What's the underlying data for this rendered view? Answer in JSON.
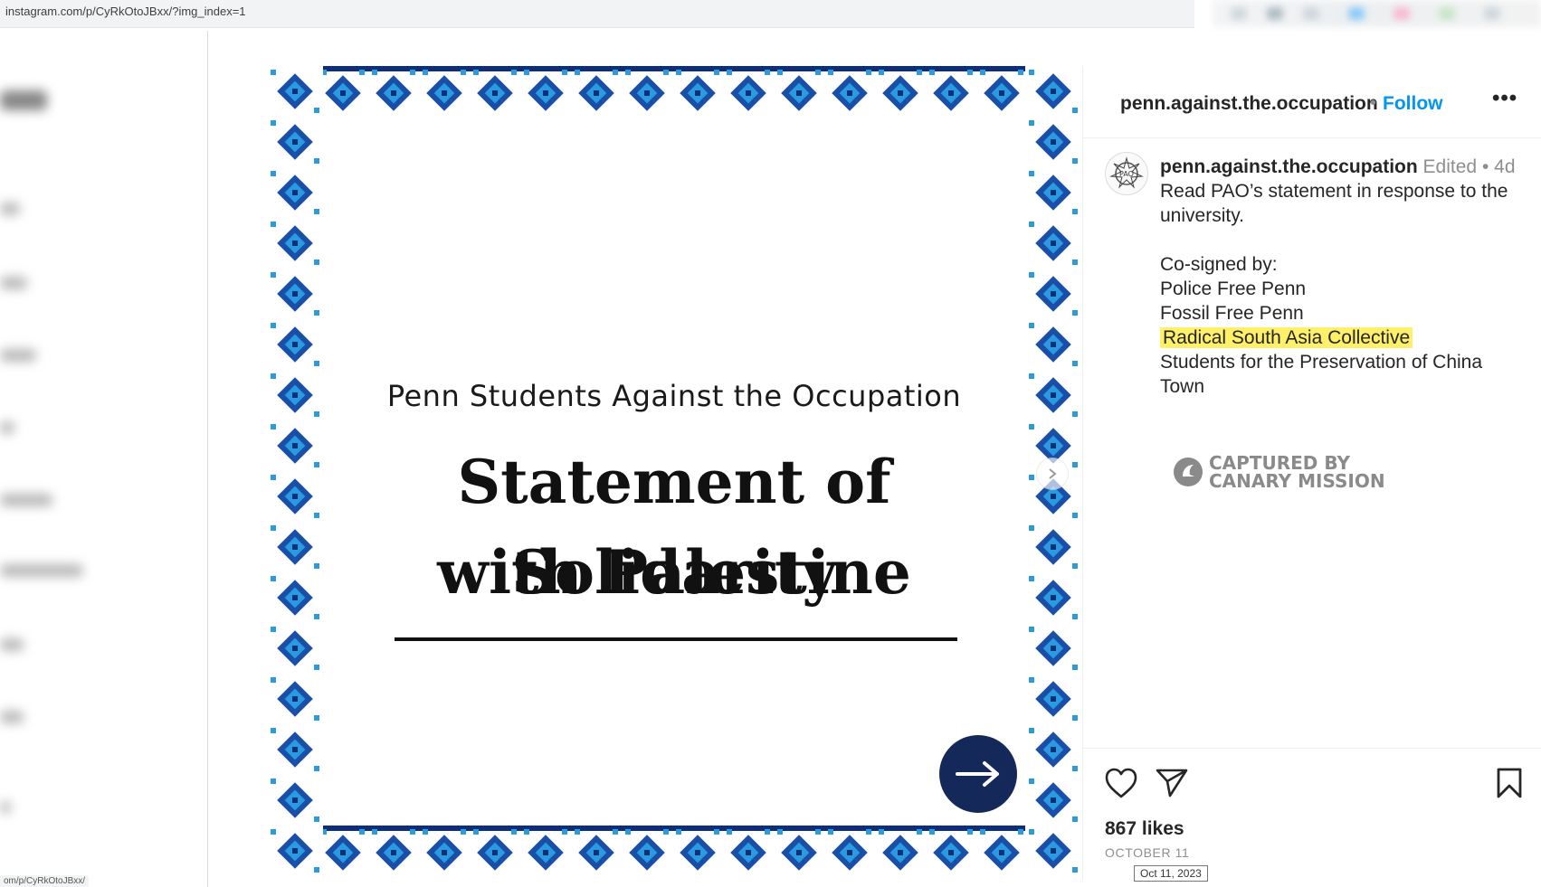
{
  "browser": {
    "url": "instagram.com/p/CyRkOtoJBxx/?img_index=1",
    "status_url": "om/p/CyRkOtoJBxx/"
  },
  "post": {
    "image": {
      "subtitle": "Penn Students Against the Occupation",
      "title_line1": "Statement of Solidarity",
      "title_line2": "with Palestine",
      "border_colors": [
        "#1a4fa8",
        "#2a9be0",
        "#0d2f7a"
      ],
      "next_circle_color": "#15285a",
      "next_icon": "arrow-right-icon"
    },
    "header": {
      "username": "penn.against.the.occupation",
      "separator": "•",
      "follow_label": "Follow",
      "more_label": "•••"
    },
    "caption": {
      "username": "penn.against.the.occupation",
      "edited": "Edited",
      "separator": "•",
      "age": "4d",
      "lines": [
        "Read PAO’s statement in response to the university.",
        "",
        "Co-signed by:",
        "Police Free Penn",
        "Fossil Free Penn",
        "Radical South Asia Collective",
        "Students for the Preservation of China Town"
      ],
      "highlight_color": "#fff06a"
    },
    "watermark": {
      "line1": "CAPTURED BY",
      "line2": "CANARY MISSION"
    },
    "actions": {
      "like_icon": "heart-icon",
      "share_icon": "send-icon",
      "save_icon": "bookmark-icon",
      "likes_text": "867 likes",
      "date_text": "OCTOBER 11",
      "tooltip_text": "Oct 11, 2023"
    },
    "accent_color": "#0095f6"
  }
}
